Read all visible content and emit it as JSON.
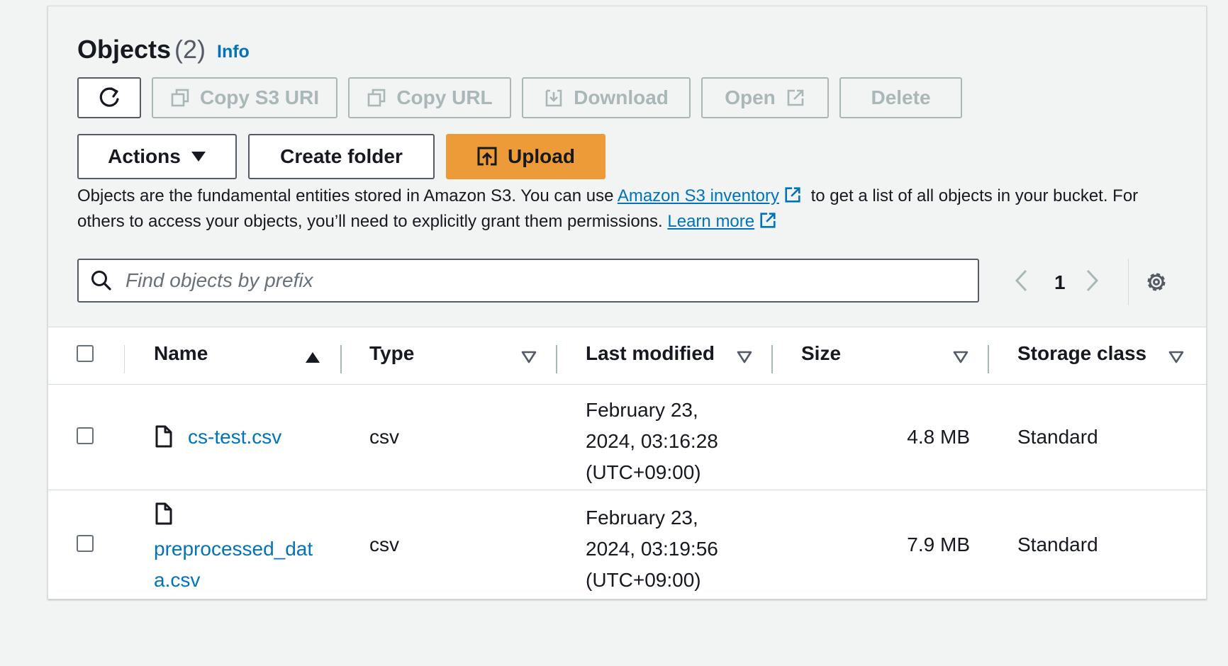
{
  "header": {
    "title": "Objects",
    "count": "(2)",
    "info": "Info"
  },
  "toolbar": {
    "copy_s3_uri": "Copy S3 URI",
    "copy_url": "Copy URL",
    "download": "Download",
    "open": "Open",
    "delete": "Delete",
    "actions": "Actions",
    "create_folder": "Create folder",
    "upload": "Upload"
  },
  "description": {
    "part1": "Objects are the fundamental entities stored in Amazon S3. You can use ",
    "inventory_link": "Amazon S3 inventory",
    "part2": " to get a list of all objects in your bucket. For others to access your objects, you’ll need to explicitly grant them permissions. ",
    "learn_more": "Learn more"
  },
  "search": {
    "placeholder": "Find objects by prefix"
  },
  "pagination": {
    "current_page": "1"
  },
  "table": {
    "columns": [
      "Name",
      "Type",
      "Last modified",
      "Size",
      "Storage class"
    ],
    "rows": [
      {
        "name": "cs-test.csv",
        "type": "csv",
        "modified_line1": "February 23,",
        "modified_line2": "2024, 03:16:28",
        "modified_line3": "(UTC+09:00)",
        "size": "4.8 MB",
        "storage_class": "Standard"
      },
      {
        "name_line1": "preprocessed_dat",
        "name_line2": "a.csv",
        "type": "csv",
        "modified_line1": "February 23,",
        "modified_line2": "2024, 03:19:56",
        "modified_line3": "(UTC+09:00)",
        "size": "7.9 MB",
        "storage_class": "Standard"
      }
    ]
  },
  "colors": {
    "link": "#0073bb",
    "primary": "#ec9b38",
    "disabled": "#aab7b8",
    "text": "#16191f"
  },
  "icons": {
    "refresh": "refresh-icon",
    "copy": "copy-icon",
    "download": "download-icon",
    "external": "external-link-icon",
    "caret": "caret-down-icon",
    "upload": "upload-icon",
    "search": "search-icon",
    "prev": "chevron-left-icon",
    "next": "chevron-right-icon",
    "settings": "gear-icon",
    "file": "file-icon",
    "sort_asc": "sort-ascending-icon",
    "sort": "sort-descending-icon"
  }
}
